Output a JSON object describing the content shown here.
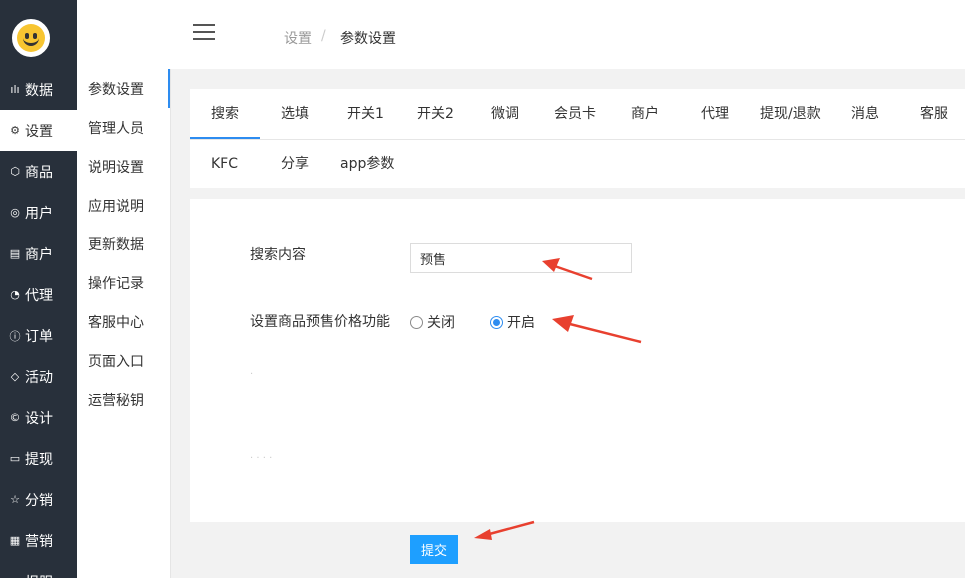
{
  "nav": {
    "items": [
      {
        "icon": "chart-icon",
        "glyph": "ılı",
        "label": "数据"
      },
      {
        "icon": "gear-icon",
        "glyph": "⚙",
        "label": "设置"
      },
      {
        "icon": "box-icon",
        "glyph": "⬡",
        "label": "商品"
      },
      {
        "icon": "user-icon",
        "glyph": "◎",
        "label": "用户"
      },
      {
        "icon": "store-icon",
        "glyph": "▤",
        "label": "商户"
      },
      {
        "icon": "agent-icon",
        "glyph": "◔",
        "label": "代理"
      },
      {
        "icon": "order-icon",
        "glyph": "ⓘ",
        "label": "订单"
      },
      {
        "icon": "tag-icon",
        "glyph": "◇",
        "label": "活动"
      },
      {
        "icon": "design-icon",
        "glyph": "©",
        "label": "设计"
      },
      {
        "icon": "withdraw-icon",
        "glyph": "▭",
        "label": "提现"
      },
      {
        "icon": "star-icon",
        "glyph": "☆",
        "label": "分销"
      },
      {
        "icon": "grid-icon",
        "glyph": "▦",
        "label": "营销"
      },
      {
        "icon": "report-icon",
        "glyph": "▭",
        "label": "报服"
      }
    ],
    "active": "设置"
  },
  "subnav": {
    "items": [
      "参数设置",
      "管理人员",
      "说明设置",
      "应用说明",
      "更新数据",
      "操作记录",
      "客服中心",
      "页面入口",
      "运营秘钥"
    ],
    "active": "参数设置"
  },
  "header": {
    "crumb_parent": "设置",
    "crumb_sep": "/",
    "crumb_current": "参数设置"
  },
  "tabs": {
    "row1": [
      "搜索",
      "选填",
      "开关1",
      "开关2",
      "微调",
      "会员卡",
      "商户",
      "代理",
      "提现/退款",
      "消息",
      "客服"
    ],
    "row2": [
      "KFC",
      "分享",
      "app参数"
    ],
    "active": "搜索"
  },
  "form": {
    "search_label": "搜索内容",
    "search_value": "预售",
    "presale_label": "设置商品预售价格功能",
    "radio_off": "关闭",
    "radio_on": "开启",
    "presale_value": "开启",
    "faint_dot": "·",
    "faint_dots": "· · · ·"
  },
  "submit_label": "提交",
  "colors": {
    "nav_bg": "#28303b",
    "accent": "#2d8cf0",
    "button": "#1e9fff",
    "annotation_arrow": "#e8402f"
  }
}
